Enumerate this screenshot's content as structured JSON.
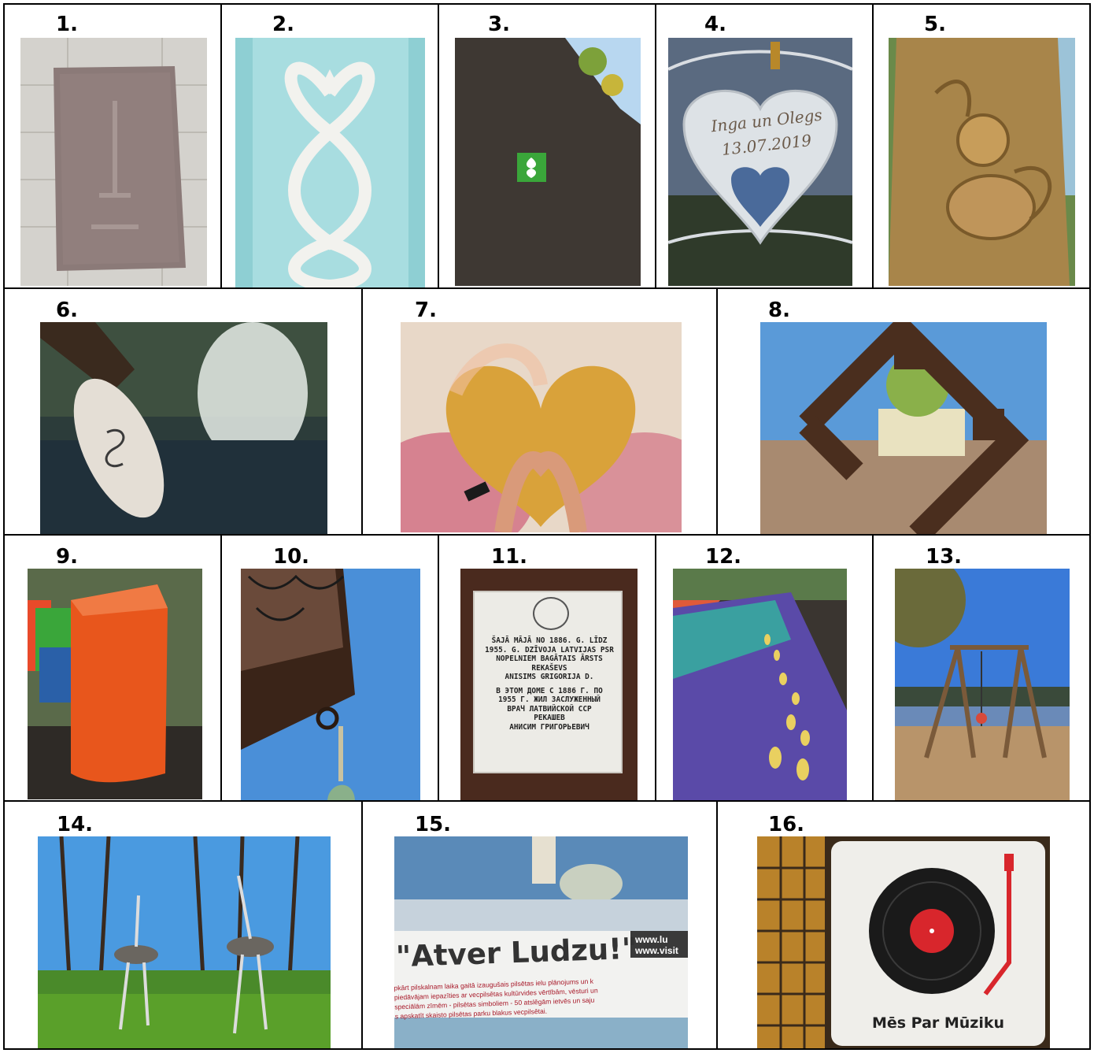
{
  "document": {
    "cells": [
      {
        "number": "1.",
        "subject": "granite-plaque"
      },
      {
        "number": "2.",
        "subject": "carved-ornament"
      },
      {
        "number": "3.",
        "subject": "tree-trail-sign"
      },
      {
        "number": "4.",
        "subject": "heart-love-lock",
        "engraving_line1": "Inga un Olegs",
        "engraving_line2": "13.07.2019"
      },
      {
        "number": "5.",
        "subject": "wood-carving"
      },
      {
        "number": "6.",
        "subject": "bench-medallion"
      },
      {
        "number": "7.",
        "subject": "heart-hands-mural"
      },
      {
        "number": "8.",
        "subject": "metal-frame-sculpture"
      },
      {
        "number": "9.",
        "subject": "orange-bollard"
      },
      {
        "number": "10.",
        "subject": "balcony-spire"
      },
      {
        "number": "11.",
        "subject": "memorial-plaque",
        "plaque_lines": [
          "ŠAJĀ MĀJĀ NO 1886. G. LĪDZ",
          "1955. G. DZĪVOJA LATVIJAS PSR",
          "NOPELNIEM BAGĀTAIS ĀRSTS",
          "REKAŠEVS",
          "ANISIMS GRIGORIJA D.",
          "В ЭТОМ ДОМЕ С 1886 Г. ПО",
          "1955 Г. ЖИЛ ЗАСЛУЖЕННЫЙ",
          "ВРАЧ ЛАТВИЙСКОЙ ССР",
          "РЕКАШЕВ",
          "АНИСИМ ГРИГОРЬЕВИЧ"
        ]
      },
      {
        "number": "12.",
        "subject": "footprint-path"
      },
      {
        "number": "13.",
        "subject": "lakeside-swing"
      },
      {
        "number": "14.",
        "subject": "ostrich-sculptures"
      },
      {
        "number": "15.",
        "subject": "info-board",
        "board_title": "\"Atver Ludzu!\"",
        "board_url_1": "www.lu",
        "board_url_2": "www.visit",
        "board_text_lines": [
          "pkārt pilskalnam laika gaitā izaugušais pilsētas ielu plānojums un k",
          "piedāvājam iepazīties ar vecpilsētas kultūrvides vērtībām, vēsturi un",
          "speciālām zīmēm - pilsētas simboliem - 50 atslēgām ietvēs un saju",
          "s apskatīt skaisto pilsētas parku blakus vecpilsētai."
        ]
      },
      {
        "number": "16.",
        "subject": "music-sign",
        "sign_text": "Mēs Par Mūziku"
      }
    ]
  },
  "colors": {
    "border": "#000000",
    "orange": "#e8561c",
    "green_sign": "#3aa63a",
    "sky": "#4a8fd8",
    "vinyl_red": "#d8262c"
  }
}
